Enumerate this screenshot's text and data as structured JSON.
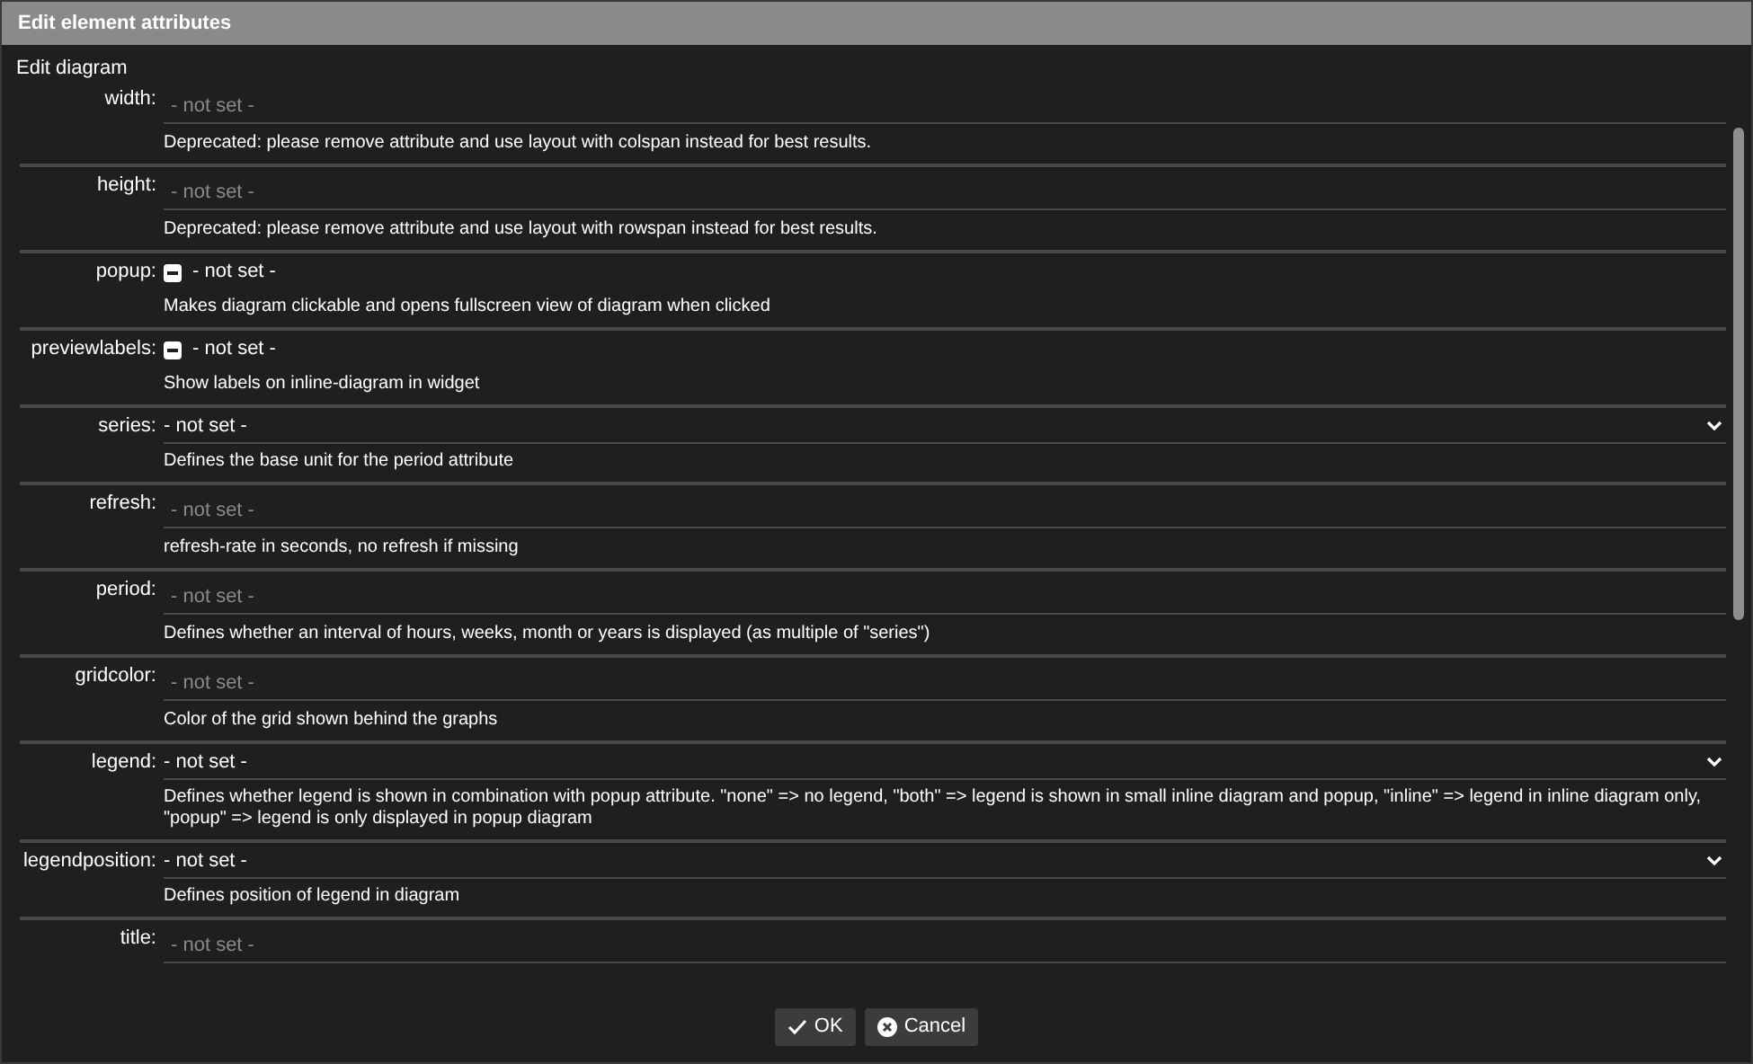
{
  "window": {
    "title": "Edit element attributes"
  },
  "section_title": "Edit diagram",
  "attributes": [
    {
      "label": "width:",
      "kind": "text",
      "placeholder": "- not set -",
      "description": "Deprecated: please remove attribute and use layout with colspan instead for best results."
    },
    {
      "label": "height:",
      "kind": "text",
      "placeholder": "- not set -",
      "description": "Deprecated: please remove attribute and use layout with rowspan instead for best results."
    },
    {
      "label": "popup:",
      "kind": "checkbox",
      "indeterminate": true,
      "value": "- not set -",
      "description": "Makes diagram clickable and opens fullscreen view of diagram when clicked"
    },
    {
      "label": "previewlabels:",
      "kind": "checkbox",
      "indeterminate": true,
      "value": "- not set -",
      "description": "Show labels on inline-diagram in widget"
    },
    {
      "label": "series:",
      "kind": "select",
      "value": "- not set -",
      "description": "Defines the base unit for the period attribute"
    },
    {
      "label": "refresh:",
      "kind": "text",
      "placeholder": "- not set -",
      "description": "refresh-rate in seconds, no refresh if missing"
    },
    {
      "label": "period:",
      "kind": "text",
      "placeholder": "- not set -",
      "description": "Defines whether an interval of hours, weeks, month or years is displayed (as multiple of \"series\")"
    },
    {
      "label": "gridcolor:",
      "kind": "text",
      "placeholder": "- not set -",
      "description": "Color of the grid shown behind the graphs"
    },
    {
      "label": "legend:",
      "kind": "select",
      "value": "- not set -",
      "description": "Defines whether legend is shown in combination with popup attribute. \"none\" => no legend, \"both\" => legend is shown in small inline diagram and popup, \"inline\" => legend in inline diagram only, \"popup\" => legend is only displayed in popup diagram"
    },
    {
      "label": "legendposition:",
      "kind": "select",
      "value": "- not set -",
      "description": "Defines position of legend in diagram"
    },
    {
      "label": "title:",
      "kind": "text",
      "placeholder": "- not set -"
    }
  ],
  "buttons": [
    {
      "label": "OK",
      "kind": "ok"
    },
    {
      "label": "Cancel",
      "kind": "cancel"
    }
  ]
}
